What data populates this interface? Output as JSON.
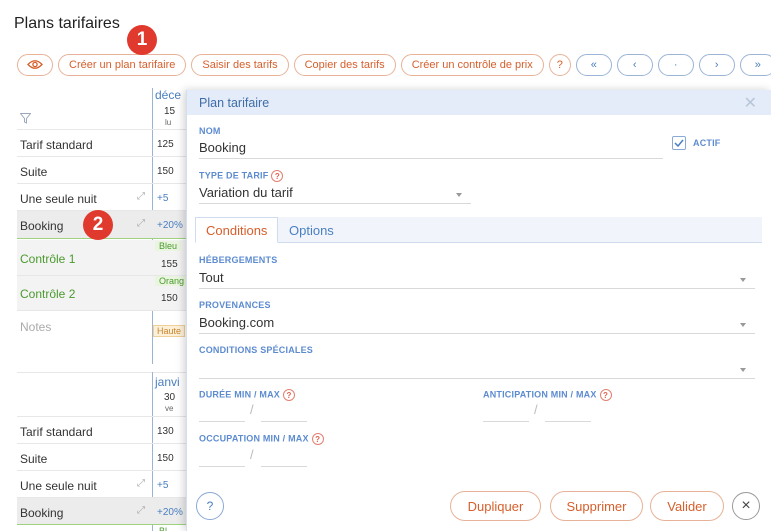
{
  "page": {
    "title": "Plans tarifaires"
  },
  "badges": {
    "one": "1",
    "two": "2"
  },
  "toolbar": {
    "view_icon": "eye-icon",
    "create_plan": "Créer un plan tarifaire",
    "enter_rates": "Saisir des tarifs",
    "copy_rates": "Copier des tarifs",
    "create_price_control": "Créer un contrôle de prix",
    "help": "?",
    "nav_first": "«",
    "nav_prev": "‹",
    "nav_today": "·",
    "nav_next": "›",
    "nav_last": "»"
  },
  "grid1": {
    "month": "déce",
    "day_num": "15",
    "day_name": "lu",
    "rows": [
      {
        "label": "Tarif standard",
        "value": "125"
      },
      {
        "label": "Suite",
        "value": "150"
      },
      {
        "label": "Une seule nuit",
        "value": "+5"
      },
      {
        "label": "Booking",
        "value": "+20%"
      }
    ],
    "control1": {
      "label": "Contrôle 1",
      "tag": "Bleu",
      "value": "155"
    },
    "control2": {
      "label": "Contrôle 2",
      "tag": "Orang",
      "value": "150"
    },
    "notes": {
      "label": "Notes",
      "tag": "Haute"
    }
  },
  "grid2": {
    "month": "janvi",
    "day_num": "30",
    "day_name": "ve",
    "rows": [
      {
        "label": "Tarif standard",
        "value": "130"
      },
      {
        "label": "Suite",
        "value": "150"
      },
      {
        "label": "Une seule nuit",
        "value": "+5"
      },
      {
        "label": "Booking",
        "value": "+20%"
      }
    ],
    "footer_tag": "Bl"
  },
  "modal": {
    "title": "Plan tarifaire",
    "name_label": "NOM",
    "name_value": "Booking",
    "active_label": "ACTIF",
    "active_checked": true,
    "type_label": "TYPE DE TARIF",
    "type_value": "Variation du tarif",
    "tabs": {
      "conditions": "Conditions",
      "options": "Options"
    },
    "accommodations_label": "HÉBERGEMENTS",
    "accommodations_value": "Tout",
    "sources_label": "PROVENANCES",
    "sources_value": "Booking.com",
    "special_label": "CONDITIONS SPÉCIALES",
    "special_value": "",
    "duration_label": "DURÉE MIN / MAX",
    "anticipation_label": "ANTICIPATION MIN / MAX",
    "occupancy_label": "OCCUPATION MIN / MAX",
    "slash": "/",
    "buttons": {
      "help": "?",
      "duplicate": "Dupliquer",
      "delete": "Supprimer",
      "validate": "Valider",
      "close": "×"
    }
  },
  "colors": {
    "accent": "#d65f2c",
    "link": "#4a7fc0",
    "control": "#4b9a2e",
    "badge": "#e03a2e"
  }
}
